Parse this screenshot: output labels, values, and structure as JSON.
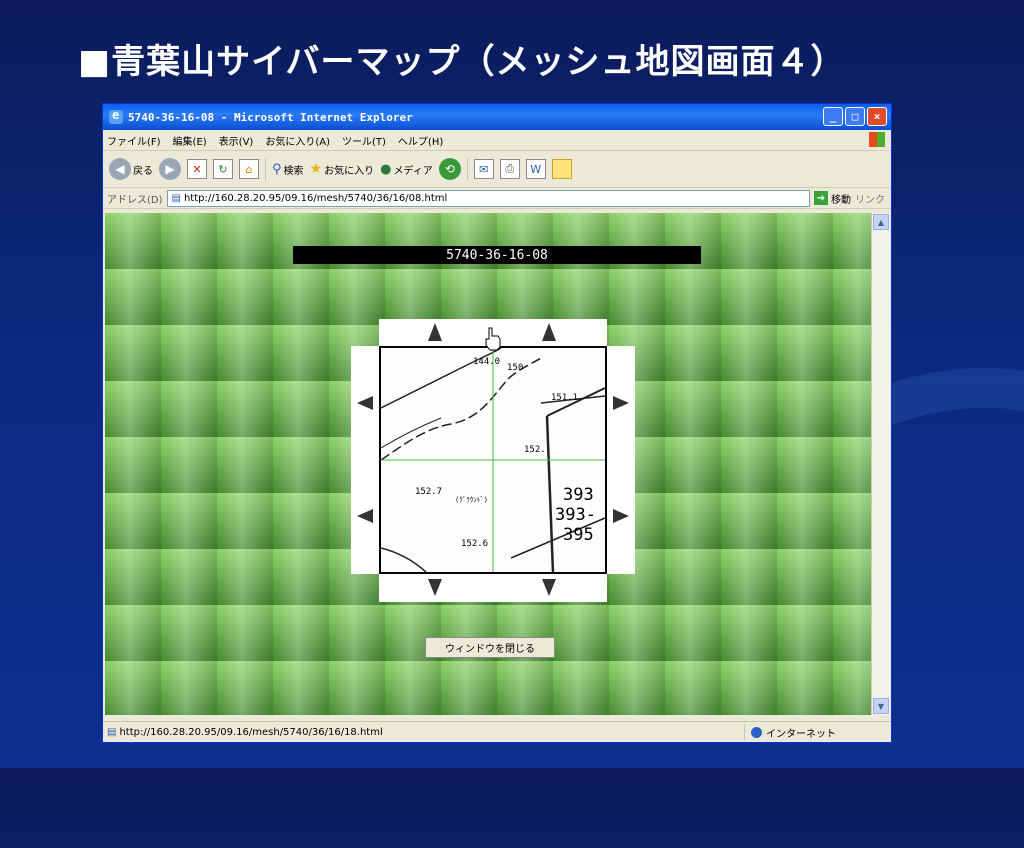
{
  "slide": {
    "title": "■青葉山サイバーマップ（メッシュ地図画面４）"
  },
  "window": {
    "title": "5740-36-16-08 - Microsoft Internet Explorer",
    "controls": [
      "_",
      "□",
      "×"
    ]
  },
  "menu": [
    "ファイル(F)",
    "編集(E)",
    "表示(V)",
    "お気に入り(A)",
    "ツール(T)",
    "ヘルプ(H)"
  ],
  "toolbar": {
    "back": "戻る",
    "search": "検索",
    "favorites": "お気に入り",
    "media": "メディア"
  },
  "address": {
    "label": "アドレス(D)",
    "url": "http://160.28.20.95/09.16/mesh/5740/36/16/08.html",
    "go": "移動",
    "links": "リンク"
  },
  "page": {
    "mesh_code": "5740-36-16-08",
    "close_button": "ウィンドウを閉じる"
  },
  "map": {
    "labels": [
      "144.0",
      "150",
      "151.1",
      "152.",
      "152.7",
      "(ｸﾞﾗｳﾝﾄﾞ)",
      "152.6",
      "393",
      "393-",
      "395"
    ]
  },
  "status": {
    "url": "http://160.28.20.95/09.16/mesh/5740/36/16/18.html",
    "zone": "インターネット"
  }
}
